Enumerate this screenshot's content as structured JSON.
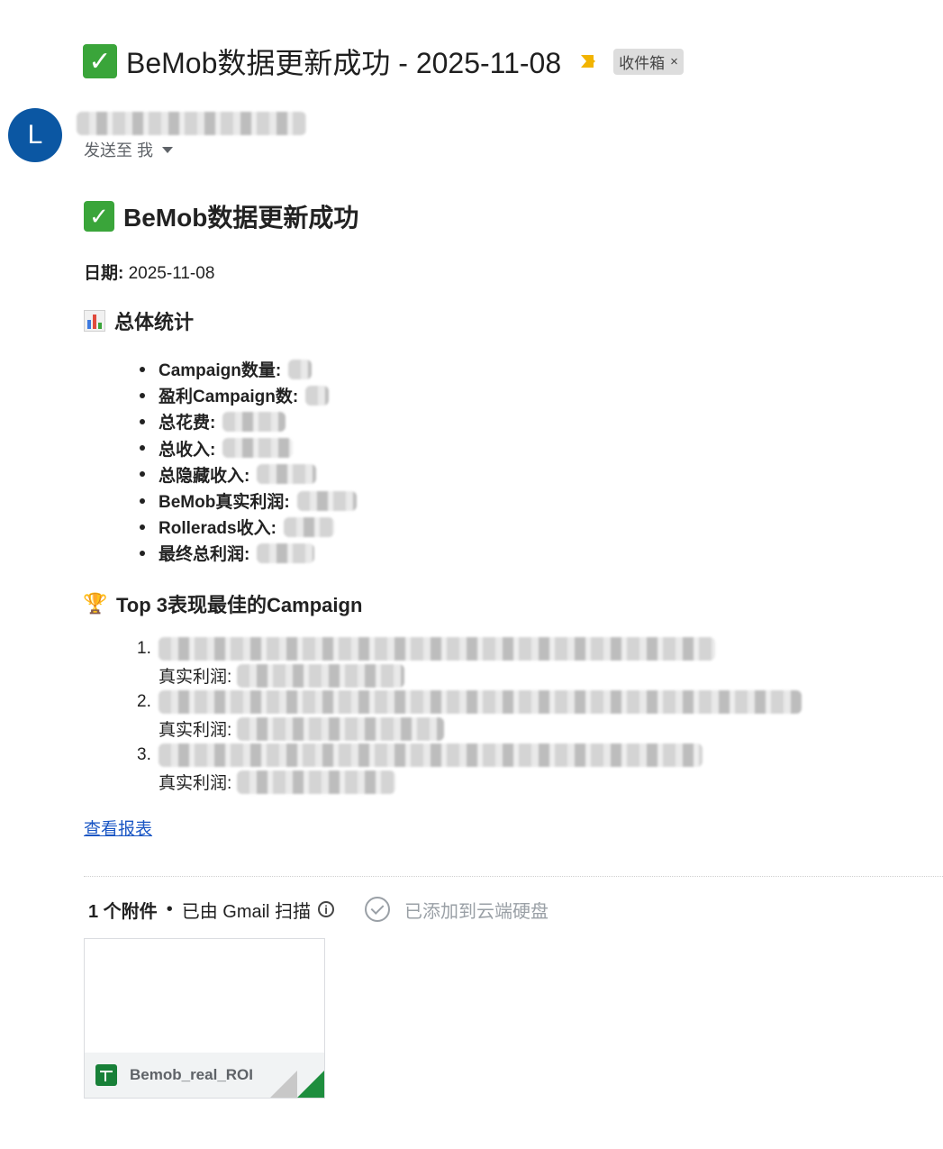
{
  "email": {
    "subject": "BeMob数据更新成功 - 2025-11-08",
    "label": "收件箱",
    "label_remove": "×",
    "sender_initial": "L",
    "sent_to": "发送至 我"
  },
  "body": {
    "heading": "BeMob数据更新成功",
    "date_label": "日期:",
    "date_value": "2025-11-08",
    "stats_title": "总体统计",
    "stats": [
      {
        "label": "Campaign数量:"
      },
      {
        "label": "盈利Campaign数:"
      },
      {
        "label": "总花费:"
      },
      {
        "label": "总收入:"
      },
      {
        "label": "总隐藏收入:"
      },
      {
        "label": "BeMob真实利润:"
      },
      {
        "label": "Rollerads收入:"
      },
      {
        "label": "最终总利润:"
      }
    ],
    "top_title": "Top 3表现最佳的Campaign",
    "top_campaigns": [
      {
        "num": "1.",
        "profit_label": "真实利润:"
      },
      {
        "num": "2.",
        "profit_label": "真实利润:"
      },
      {
        "num": "3.",
        "profit_label": "真实利润:"
      }
    ],
    "report_link": "查看报表"
  },
  "attachments": {
    "count": "1 个附件",
    "separator": "•",
    "scan_text": "已由 Gmail 扫描",
    "drive_text": "已添加到云端硬盘",
    "file_name": "Bemob_real_ROI"
  },
  "colors": {
    "avatar": "#0b57a3",
    "link": "#1a56c4",
    "check": "#3aa53a",
    "sheets": "#188038"
  }
}
